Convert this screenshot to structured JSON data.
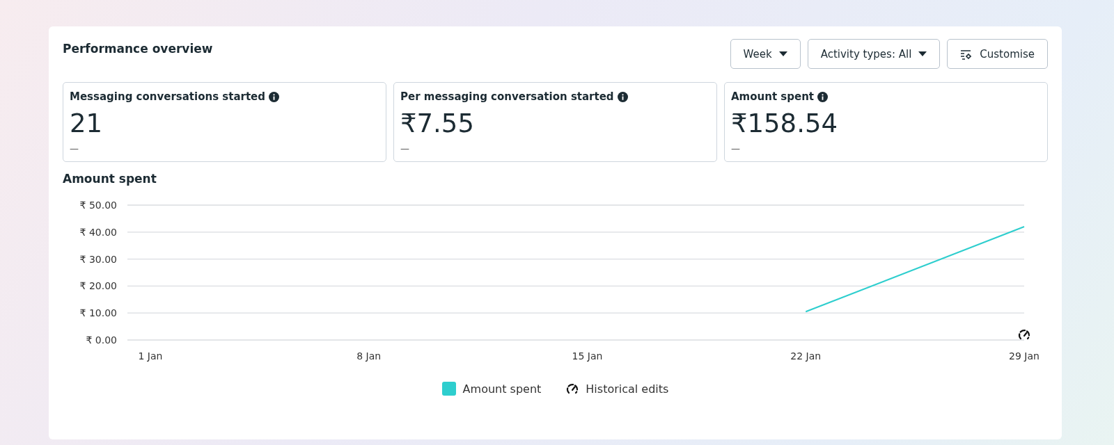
{
  "header": {
    "title": "Performance overview",
    "controls": [
      {
        "kind": "dropdown",
        "label": "Week"
      },
      {
        "kind": "dropdown",
        "label": "Activity types: All"
      },
      {
        "kind": "customise",
        "label": "Customise"
      }
    ]
  },
  "metrics": [
    {
      "title": "Messaging conversations started",
      "value": "21",
      "comparison": "—"
    },
    {
      "title": "Per messaging conversation started",
      "value": "₹7.55",
      "comparison": "—"
    },
    {
      "title": "Amount spent",
      "value": "₹158.54",
      "comparison": "—"
    }
  ],
  "chart_section": {
    "title": "Amount spent",
    "chart_data": {
      "type": "line",
      "categories": [
        "1 Jan",
        "8 Jan",
        "15 Jan",
        "22 Jan",
        "29 Jan"
      ],
      "series": [
        {
          "name": "Amount spent",
          "color": "#2ecece",
          "values": [
            null,
            null,
            null,
            10.5,
            42
          ]
        }
      ],
      "grid": true,
      "ylim": [
        0,
        50
      ],
      "yticks": [
        {
          "value": 0,
          "label": "₹ 0.00"
        },
        {
          "value": 10,
          "label": "₹ 10.00"
        },
        {
          "value": 20,
          "label": "₹ 20.00"
        },
        {
          "value": 30,
          "label": "₹ 30.00"
        },
        {
          "value": 40,
          "label": "₹ 40.00"
        },
        {
          "value": 50,
          "label": "₹ 50.00"
        }
      ]
    },
    "legend_extra": [
      {
        "kind": "edits",
        "label": "Historical edits"
      }
    ]
  }
}
